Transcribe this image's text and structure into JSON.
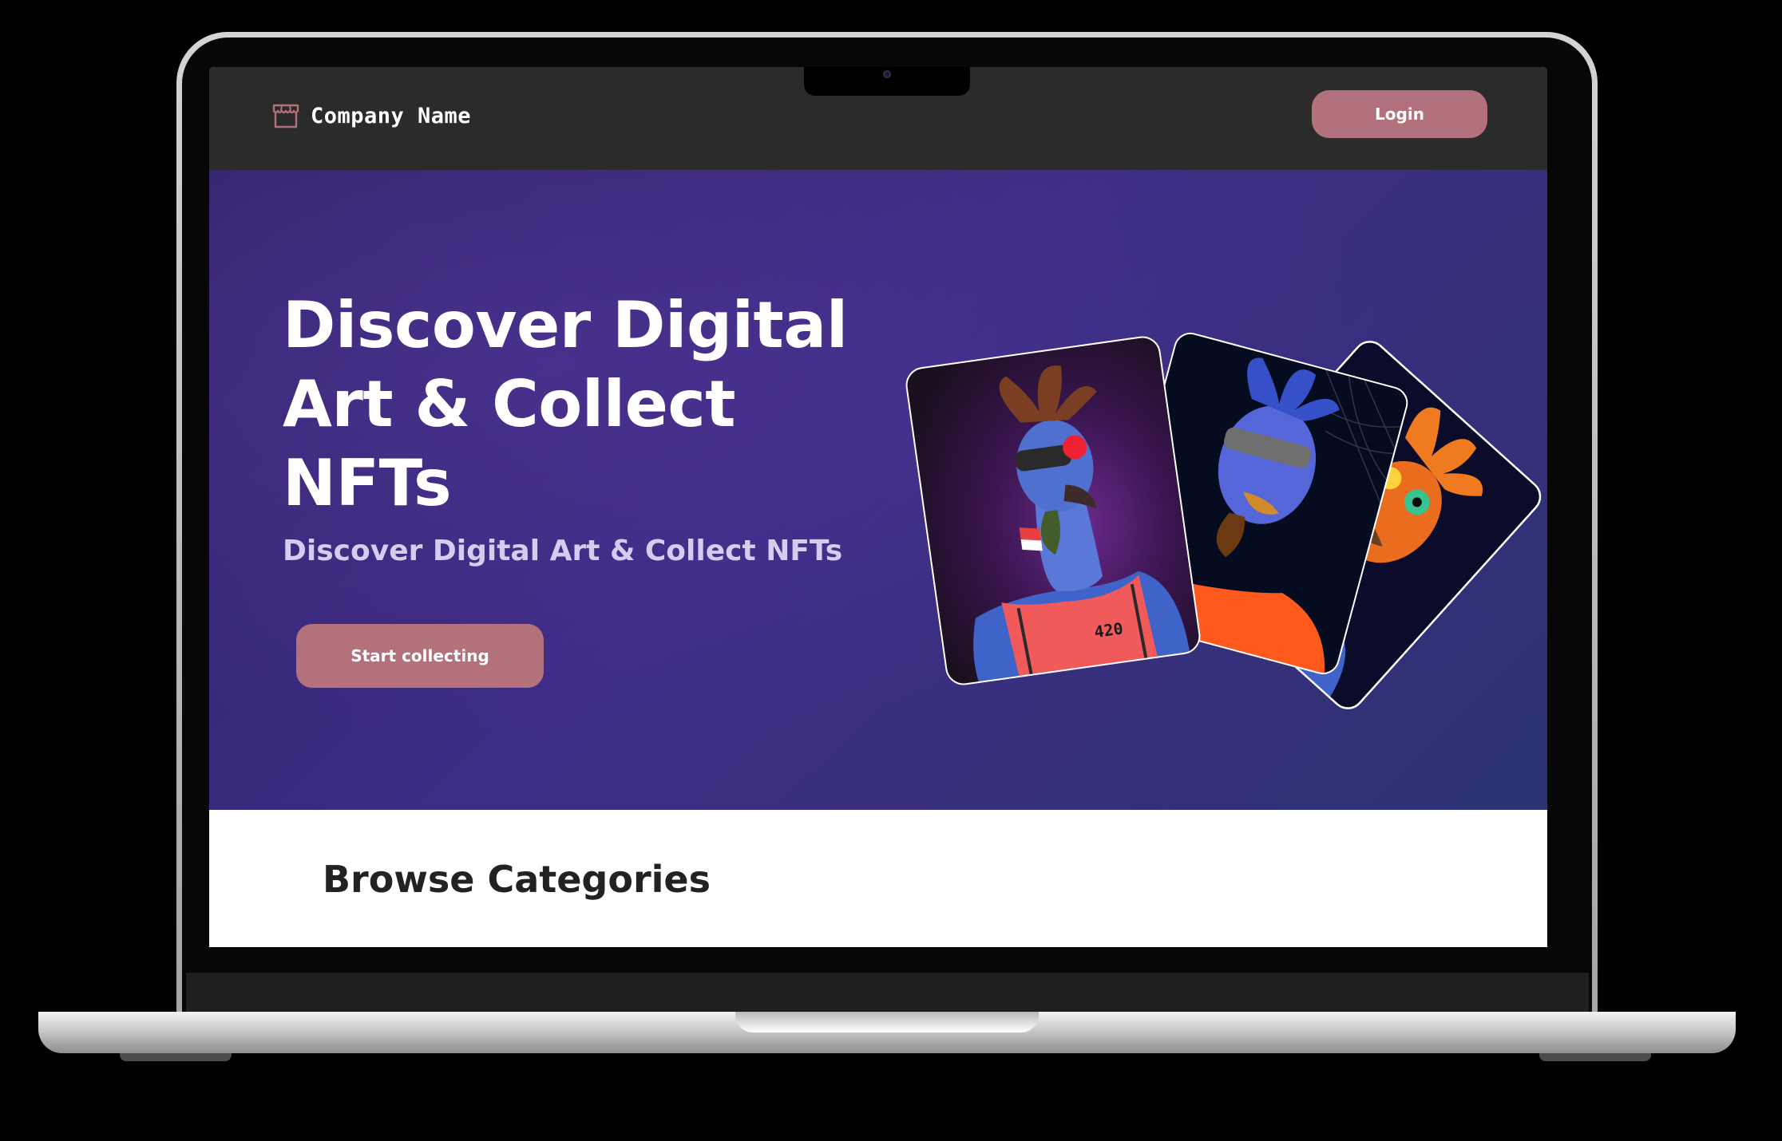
{
  "navbar": {
    "brand_name": "Company Name",
    "brand_icon": "storefront-icon",
    "login_label": "Login"
  },
  "hero": {
    "title": "Discover Digital Art & Collect NFTs",
    "subtitle": "Discover Digital Art & Collect NFTs",
    "cta_label": "Start collecting",
    "nft_cards": [
      {
        "name": "nft-card-back",
        "character": "turkey-orange-crest"
      },
      {
        "name": "nft-card-middle",
        "character": "turkey-blue-crest"
      },
      {
        "name": "nft-card-front",
        "character": "turkey-brown-crest",
        "shirt_number": "420"
      }
    ]
  },
  "browse": {
    "title": "Browse Categories"
  },
  "colors": {
    "accent": "#b2717b",
    "navbar_bg": "#2b2b2b",
    "hero_bg": "#3a2a7e"
  }
}
